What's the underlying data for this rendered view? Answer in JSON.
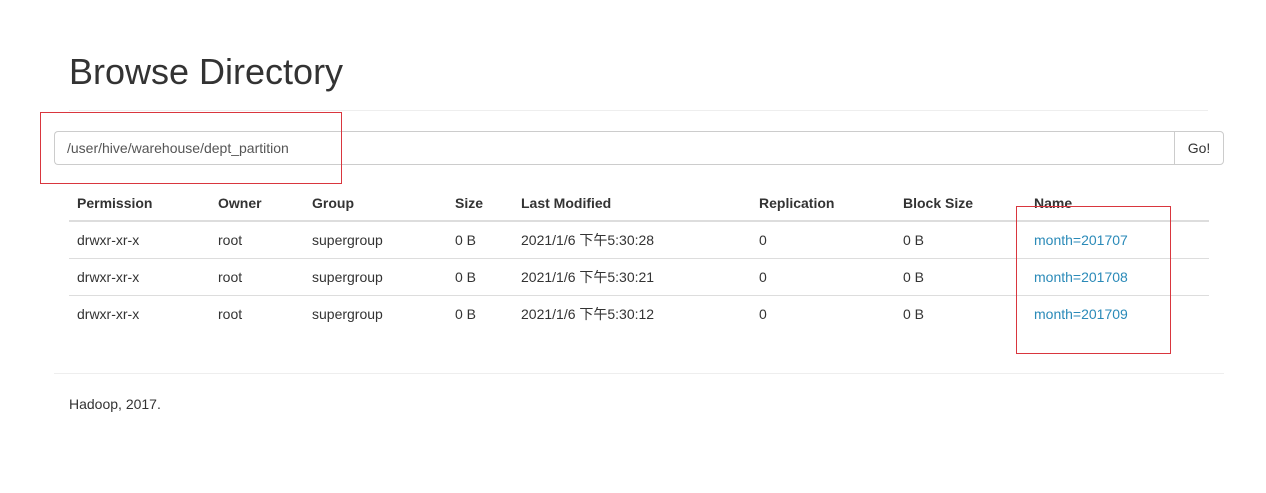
{
  "header": {
    "title": "Browse Directory"
  },
  "path_bar": {
    "value": "/user/hive/warehouse/dept_partition",
    "go_label": "Go!"
  },
  "table": {
    "columns": [
      "Permission",
      "Owner",
      "Group",
      "Size",
      "Last Modified",
      "Replication",
      "Block Size",
      "Name"
    ],
    "rows": [
      {
        "permission": "drwxr-xr-x",
        "owner": "root",
        "group": "supergroup",
        "size": "0 B",
        "last_modified": "2021/1/6 下午5:30:28",
        "replication": "0",
        "block_size": "0 B",
        "name": "month=201707"
      },
      {
        "permission": "drwxr-xr-x",
        "owner": "root",
        "group": "supergroup",
        "size": "0 B",
        "last_modified": "2021/1/6 下午5:30:21",
        "replication": "0",
        "block_size": "0 B",
        "name": "month=201708"
      },
      {
        "permission": "drwxr-xr-x",
        "owner": "root",
        "group": "supergroup",
        "size": "0 B",
        "last_modified": "2021/1/6 下午5:30:12",
        "replication": "0",
        "block_size": "0 B",
        "name": "month=201709"
      }
    ]
  },
  "footer": {
    "text": "Hadoop, 2017."
  },
  "colors": {
    "link": "#2a8ab8",
    "annotation_box": "#d9363e"
  }
}
